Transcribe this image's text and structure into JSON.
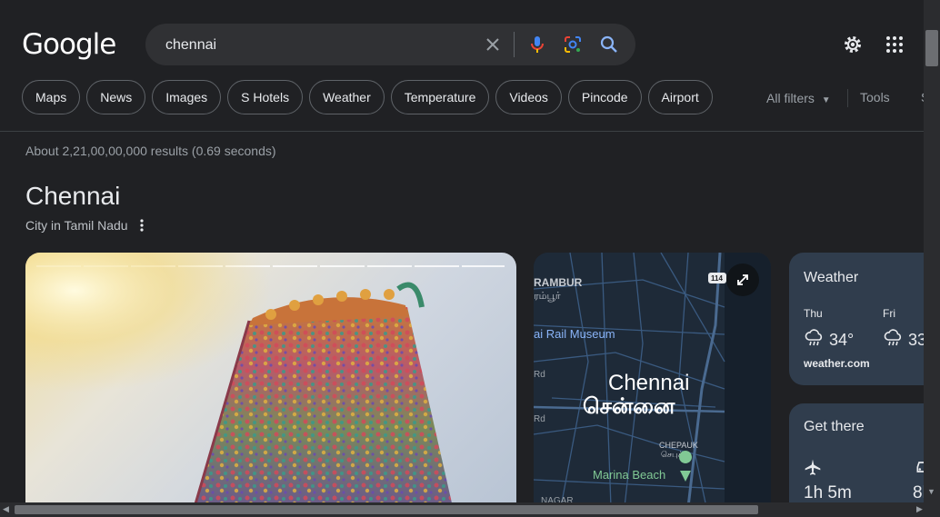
{
  "logo": "Google",
  "search": {
    "value": "chennai",
    "clear_icon": "close-icon",
    "mic_icon": "mic-icon",
    "lens_icon": "lens-icon",
    "search_icon": "search-icon"
  },
  "header_icons": [
    "gear-icon",
    "apps-grid-icon"
  ],
  "chips": [
    "Maps",
    "News",
    "Images",
    "S Hotels",
    "Weather",
    "Temperature",
    "Videos",
    "Pincode",
    "Airport"
  ],
  "filters": {
    "all_filters": "All filters",
    "tools": "Tools",
    "extra": "S"
  },
  "results_stats": "About 2,21,00,00,000 results (0.69 seconds)",
  "knowledge_panel": {
    "title": "Chennai",
    "subtitle": "City in Tamil Nadu"
  },
  "map": {
    "labels": {
      "rambur": "RAMBUR",
      "rambur_ta": "ரம்பூர்",
      "museum": "ai Rail Museum",
      "rd1": "Rd",
      "rd2": "Rd",
      "city": "Chennai",
      "city_ta": "சென்னை",
      "chepauk": "CHEPAUK",
      "chepauk_ta": "செபுக்",
      "marina": "Marina Beach",
      "nagar": "NAGAR",
      "route": "114"
    }
  },
  "weather": {
    "title": "Weather",
    "days": [
      {
        "day": "Thu",
        "temp": "34°",
        "icon": "rain-cloud-icon"
      },
      {
        "day": "Fri",
        "temp": "33",
        "icon": "rain-cloud-icon"
      }
    ],
    "source": "weather.com"
  },
  "get_there": {
    "title": "Get there",
    "flight_time": "1h 5m",
    "other_time": "8h"
  },
  "colors": {
    "background": "#202124",
    "card": "#303d4d",
    "accent_blue": "#8ab4f8",
    "map_bg": "#1e2a38"
  }
}
